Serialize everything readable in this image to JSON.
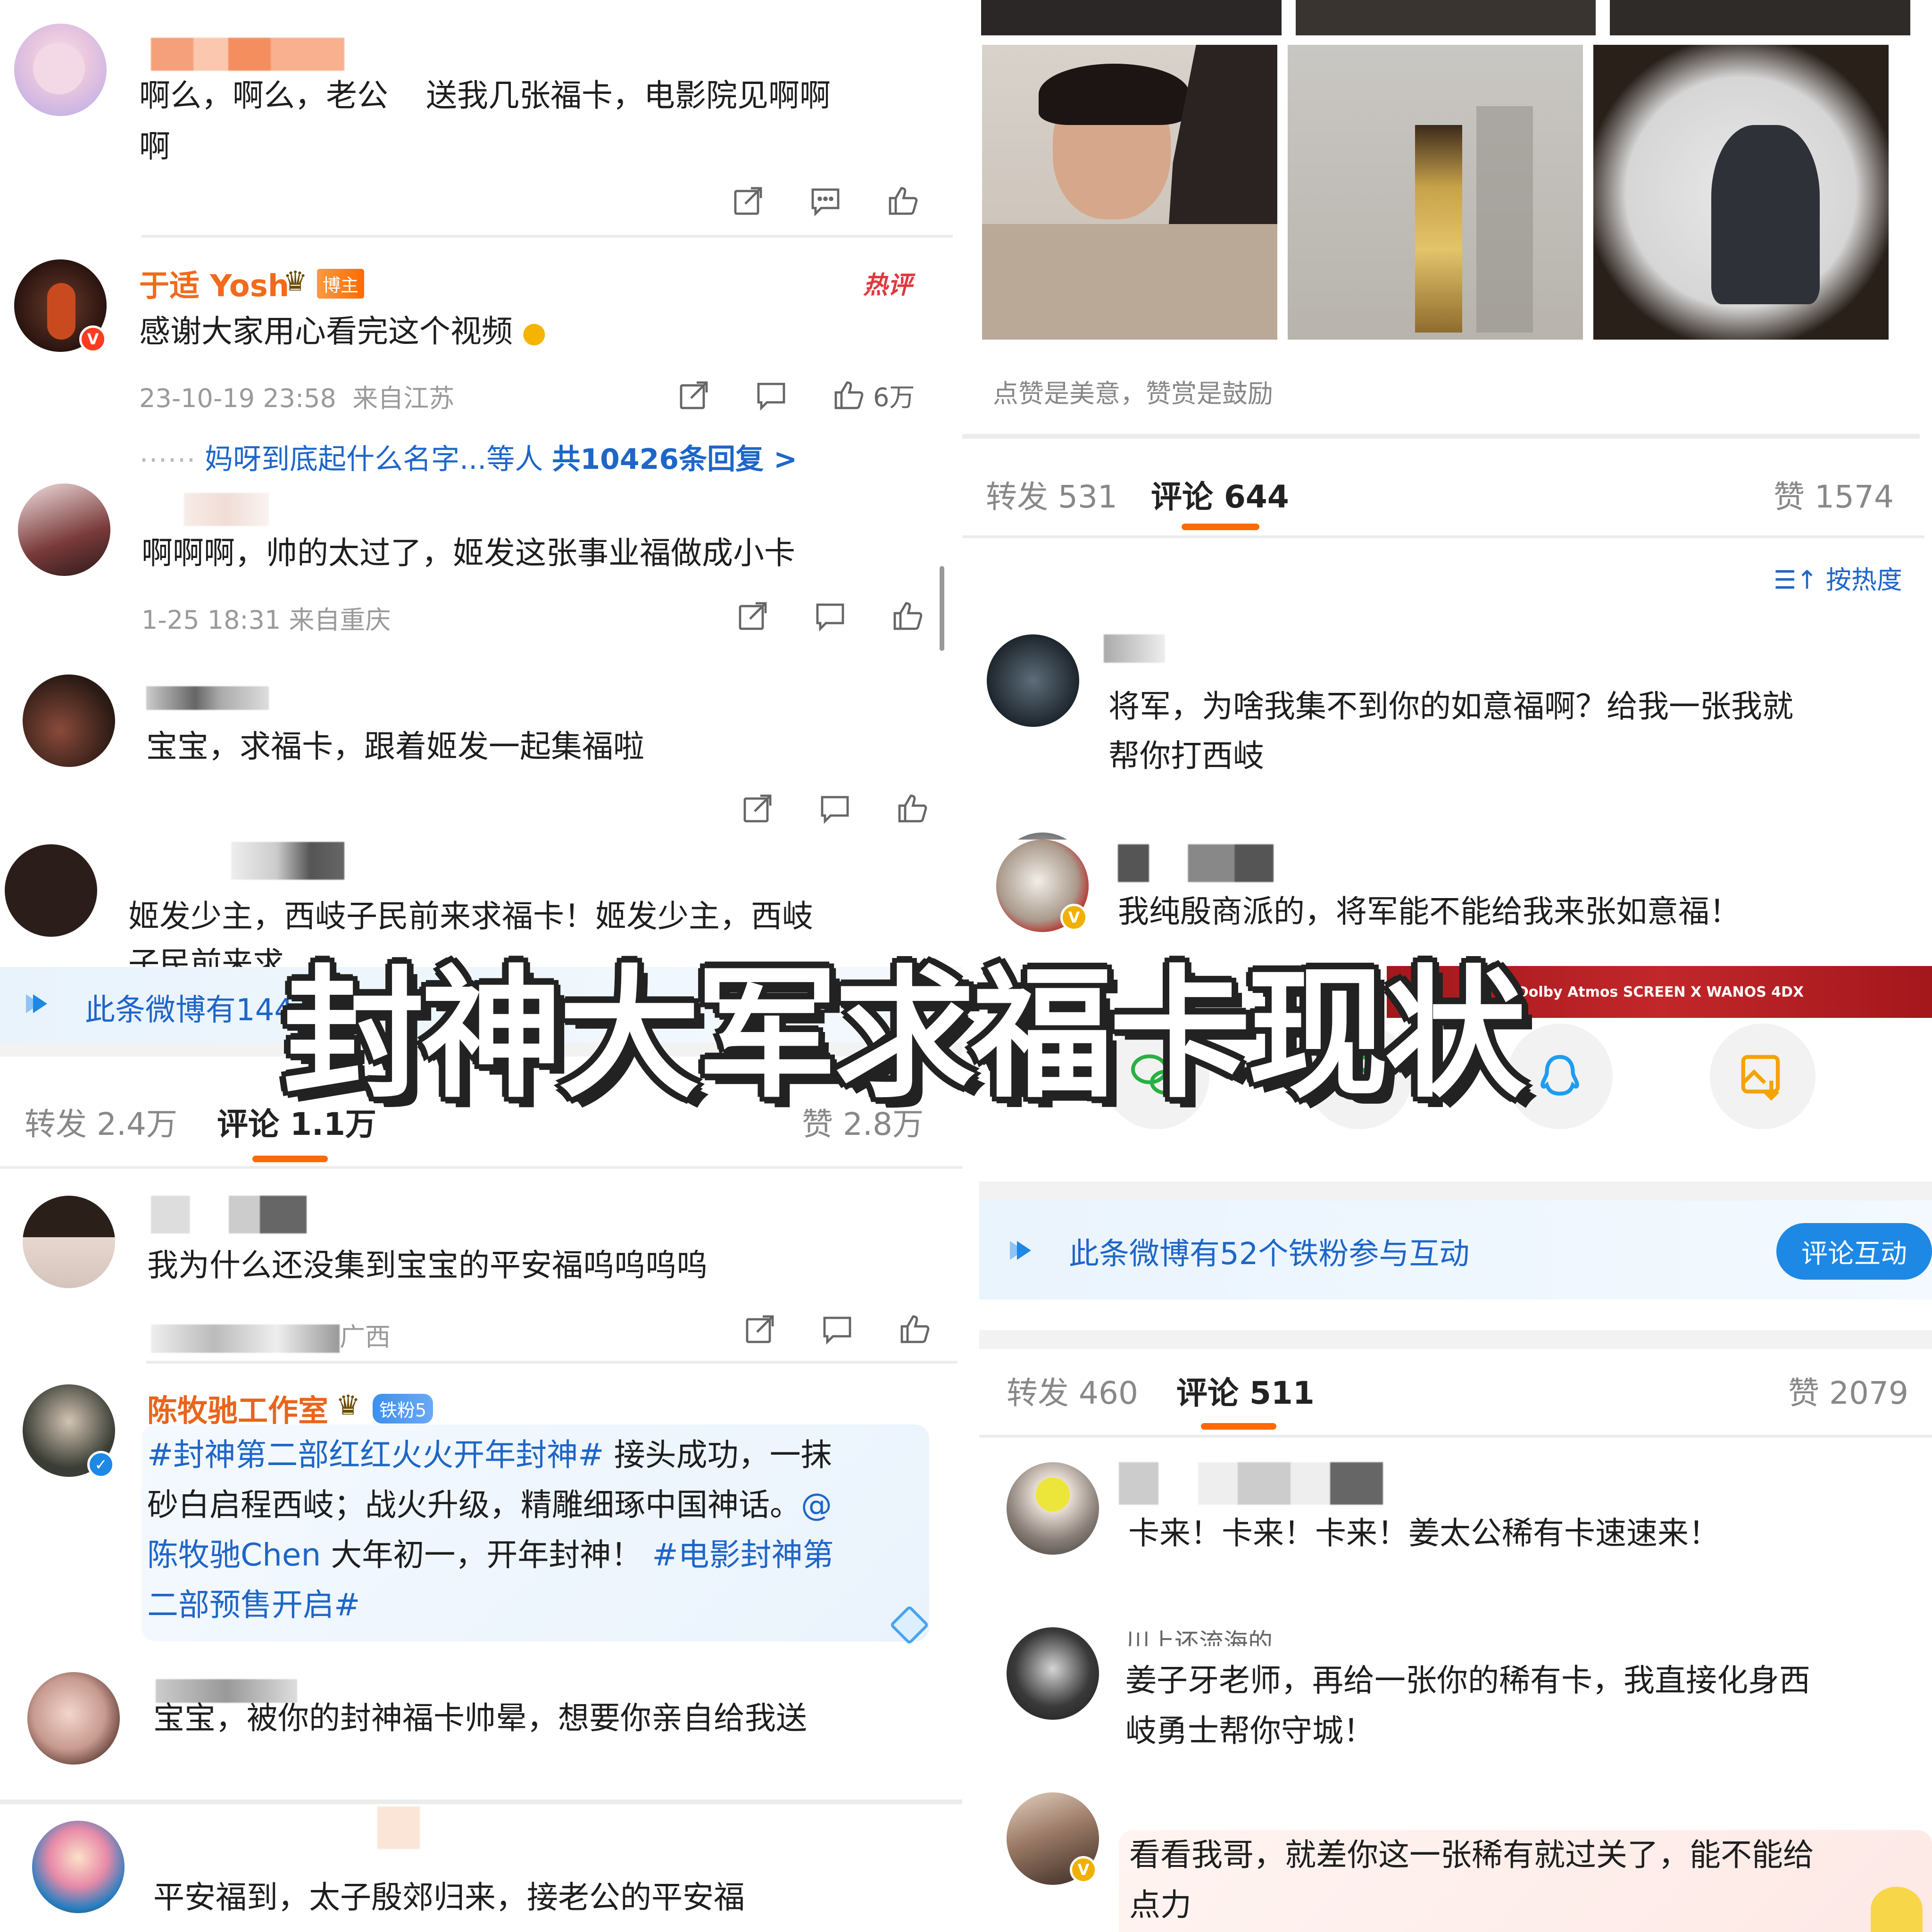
{
  "title_overlay": "封神大军求福卡现状",
  "tl": {
    "c1": {
      "text_a": "啊么，啊么，老公",
      "text_b": "送我几张福卡，电影院见啊啊",
      "text_c": "啊"
    },
    "c2": {
      "name": "于适 Yosh",
      "badge": "博主",
      "hot": "热评",
      "text": "感谢大家用心看完这个视频",
      "time": "23-10-19 23:58",
      "loc": "来自江苏",
      "likes": "6万",
      "replies_dots": "⋯⋯",
      "replies_users": "妈呀到底起什么名字...等人",
      "replies_count": "共10426条回复 >"
    },
    "c3": {
      "text": "啊啊啊，帅的太过了，姬发这张事业福做成小卡",
      "time": "1-25 18:31",
      "loc": "来自重庆"
    },
    "c4": {
      "text": "宝宝，求福卡，跟着姬发一起集福啦"
    },
    "c5": {
      "text_a": "姬发少主，西岐子民前来求福卡！姬发少主，西岐",
      "text_b": "子民前来求"
    },
    "fans_bar": "此条微博有144"
  },
  "tr": {
    "caption": "点赞是美意，赞赏是鼓励",
    "tabs": {
      "repost": "转发 531",
      "comment": "评论 644",
      "like": "赞 1574"
    },
    "sort": "按热度",
    "c1": {
      "text_a": "将军，为啥我集不到你的如意福啊？给我一张我就",
      "text_b": "帮你打西岐"
    },
    "c2": {
      "text": "我纯殷商派的，将军能不能给我来张如意福！"
    },
    "banner": "Dolby Atmos  SCREEN X  WANOS  4DX"
  },
  "bl": {
    "tabs": {
      "repost": "转发 2.4万",
      "comment": "评论 1.1万",
      "like": "赞 2.8万"
    },
    "c1": {
      "text": "我为什么还没集到宝宝的平安福呜呜呜呜",
      "loc": "广西"
    },
    "c2": {
      "name": "陈牧驰工作室",
      "badge": "铁粉5",
      "tag1": "#封神第二部红红火火开年封神#",
      "t1": "接头成功，一抹",
      "t2": "砂白启程西岐；战火升级，精雕细琢中国神话。",
      "at": "@",
      "at2": "陈牧驰Chen",
      "t3": "大年初一，开年封神！",
      "tag2a": "#电影封神第",
      "tag2b": "二部预售开启#"
    },
    "c3": {
      "text": "宝宝，被你的封神福卡帅晕，想要你亲自给我送"
    },
    "c4": {
      "text": "平安福到，太子殷郊归来，接老公的平安福"
    }
  },
  "br": {
    "fans_bar": "此条微博有52个铁粉参与互动",
    "fans_btn": "评论互动",
    "tabs": {
      "repost": "转发 460",
      "comment": "评论 511",
      "like": "赞 2079"
    },
    "c1": {
      "text": "卡来！卡来！卡来！姜太公稀有卡速速来！"
    },
    "c2": {
      "name": "川上还流海的",
      "text_a": "姜子牙老师，再给一张你的稀有卡，我直接化身西",
      "text_b": "岐勇士帮你守城！"
    },
    "c3": {
      "text_a": "看看我哥，就差你这一张稀有就过关了，能不能给",
      "text_b": "点力"
    }
  },
  "colors": {
    "accent": "#ff6a00",
    "link": "#1e66c8",
    "name_orange": "#f26a1b"
  }
}
